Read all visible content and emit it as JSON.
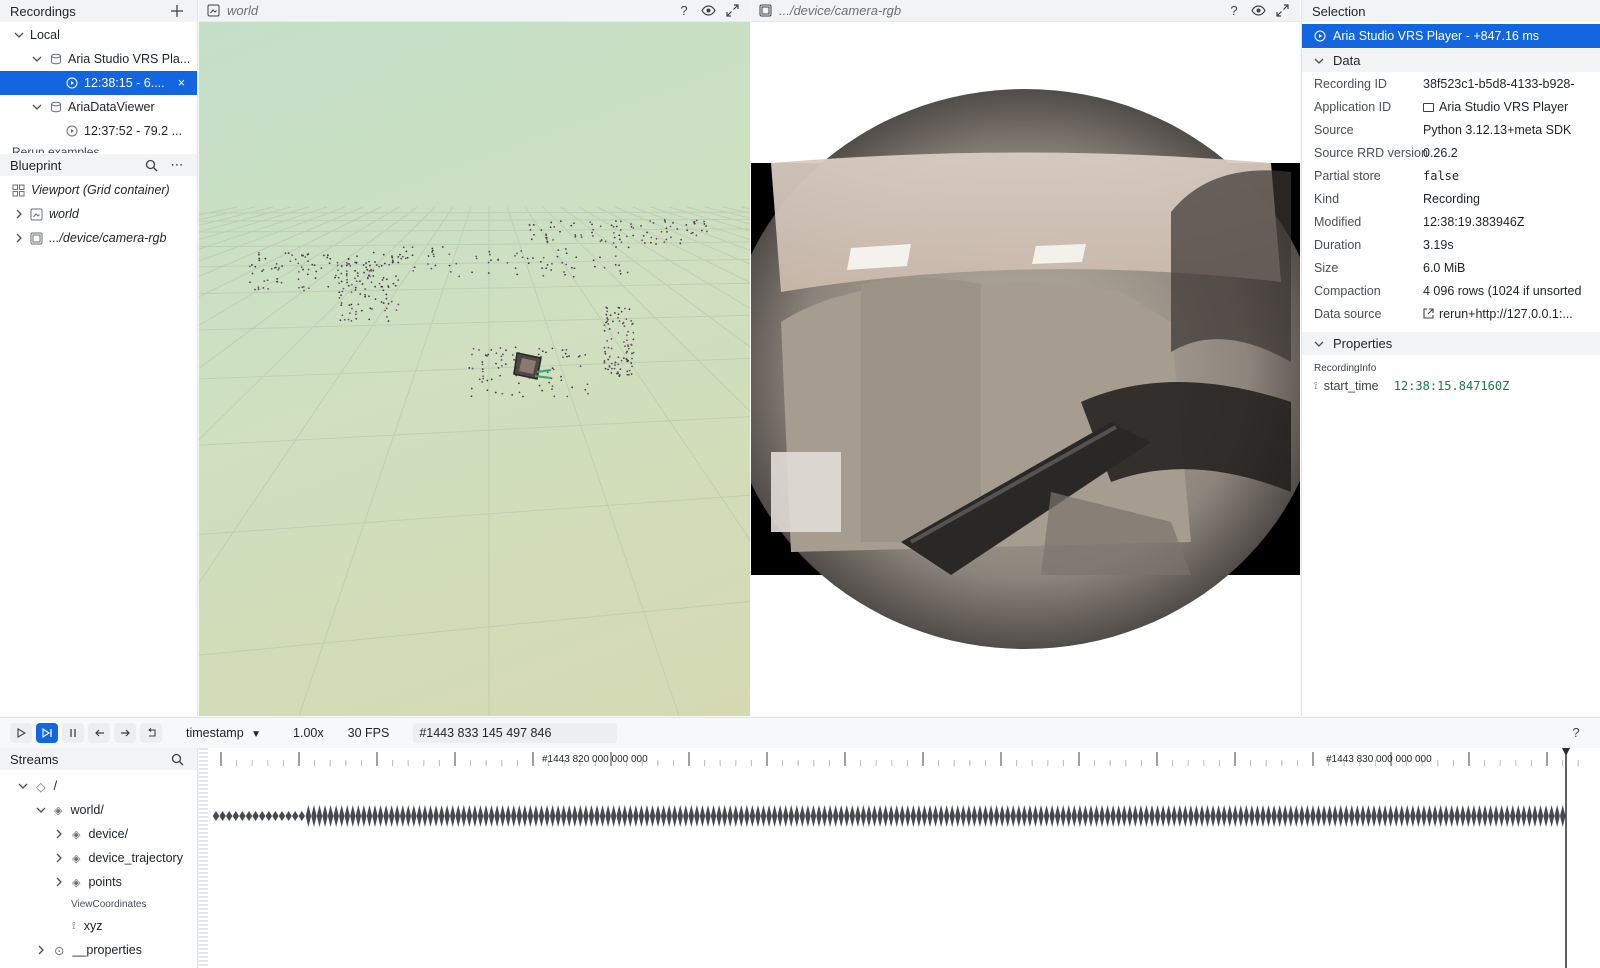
{
  "recordings": {
    "title": "Recordings",
    "local_label": "Local",
    "apps": [
      {
        "name": "Aria Studio VRS Pla...",
        "entry": "12:38:15 - 6...."
      },
      {
        "name": "AriaDataViewer",
        "entry": "12:37:52 - 79.2 ..."
      }
    ],
    "examples_label": "Rerun examples"
  },
  "blueprint": {
    "title": "Blueprint",
    "items": [
      {
        "label": "Viewport (Grid container)"
      },
      {
        "label": "world"
      },
      {
        "label": ".../device/camera-rgb"
      }
    ]
  },
  "views": {
    "world_title": "world",
    "camera_title": ".../device/camera-rgb"
  },
  "selection": {
    "title": "Selection",
    "selected_item": "Aria Studio VRS Player - +847.16 ms",
    "data_section": "Data",
    "rows": [
      {
        "key": "Recording ID",
        "value": "38f523c1-b5d8-4133-b928-"
      },
      {
        "key": "Application ID",
        "value": "Aria Studio VRS Player"
      },
      {
        "key": "Source",
        "value": "Python 3.12.13+meta SDK"
      },
      {
        "key": "Source RRD version",
        "value": "0.26.2"
      },
      {
        "key": "Partial store",
        "value": "false"
      },
      {
        "key": "Kind",
        "value": "Recording"
      },
      {
        "key": "Modified",
        "value": "12:38:19.383946Z"
      },
      {
        "key": "Duration",
        "value": "3.19s"
      },
      {
        "key": "Size",
        "value": "6.0 MiB"
      },
      {
        "key": "Compaction",
        "value": "4 096 rows (1024 if unsorted"
      },
      {
        "key": "Data source",
        "value": "rerun+http://127.0.0.1:..."
      }
    ],
    "properties_section": "Properties",
    "properties_group": "RecordingInfo",
    "property": {
      "key": "start_time",
      "value": "12:38:15.847160Z"
    }
  },
  "timeline": {
    "timeline_name": "timestamp",
    "speed": "1.00x",
    "fps": "30 FPS",
    "current_time": "#1443 833 145 497 846",
    "help": "?",
    "major_labels": [
      {
        "label": "#1443 820 000 000 000"
      },
      {
        "label": "#1443 830 000 000 000"
      }
    ]
  },
  "streams": {
    "title": "Streams",
    "tree": [
      {
        "label": "/"
      },
      {
        "label": "world/"
      },
      {
        "label": "device/"
      },
      {
        "label": "device_trajectory"
      },
      {
        "label": "points"
      },
      {
        "label": "ViewCoordinates"
      },
      {
        "label": "xyz"
      },
      {
        "label": "__properties"
      }
    ]
  },
  "colors": {
    "accent": "#1466e0",
    "panel_bg": "#f1f3f5",
    "property_value": "#1a7a4c"
  }
}
